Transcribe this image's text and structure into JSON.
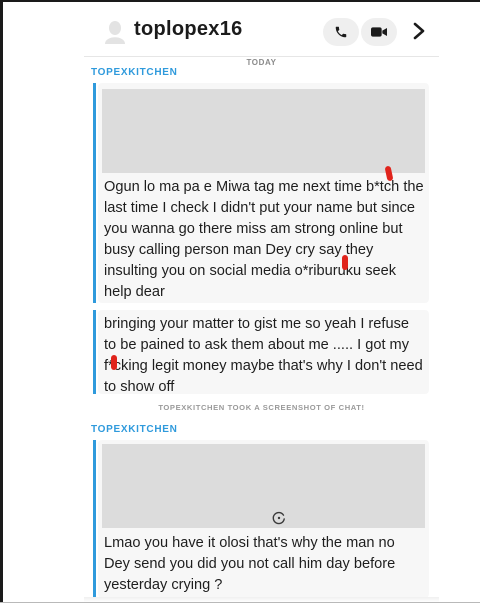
{
  "header": {
    "title": "toplopex16",
    "call_icon": "phone-icon",
    "video_icon": "video-camera-icon",
    "nav_icon": "chevron-right-icon"
  },
  "day_divider": "TODAY",
  "messages": [
    {
      "sender": "TOPEXKITCHEN",
      "has_media": true,
      "text": "Ogun lo ma pa e Miwa tag me next time b*tch the last time I check I didn't put your name but since you wanna go there miss am strong online but busy calling person man Dey cry say they insulting you on social media o*riburuku seek help dear"
    },
    {
      "text": "bringing your matter to gist me so yeah I refuse to be pained to ask them about me ..... I got my f*cking legit money maybe that's why I don't need to show off"
    },
    {
      "notice": "TOPEXKITCHEN TOOK A SCREENSHOT OF CHAT!"
    },
    {
      "sender": "TOPEXKITCHEN",
      "has_media": true,
      "media_loading_icon": "loading-spinner-icon",
      "text": "Lmao you have it olosi that's why the man no Dey send you did you not call him day before yesterday crying ?"
    }
  ],
  "colors": {
    "accent": "#2f9adc",
    "redaction": "#e0241c",
    "media_placeholder": "#dcdcdc",
    "bubble_bg": "#f7f7f7"
  }
}
